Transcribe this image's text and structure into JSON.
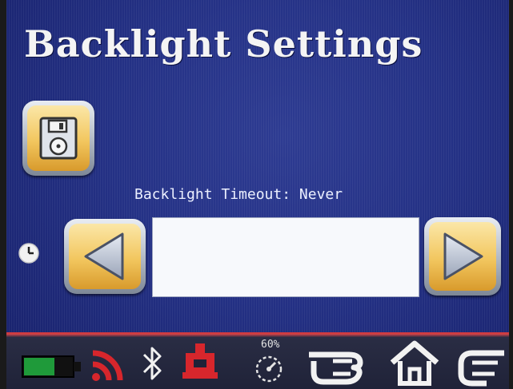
{
  "screen": {
    "title": "Backlight Settings"
  },
  "settings": {
    "timeout_label": "Backlight Timeout: Never",
    "value": ""
  },
  "buttons": {
    "save_icon": "floppy-disk-icon",
    "prev_icon": "arrow-left-icon",
    "next_icon": "arrow-right-icon",
    "timer_icon": "clock-icon"
  },
  "status_bar": {
    "battery": "battery-icon",
    "signal": "signal-icon",
    "bluetooth": "bluetooth-icon",
    "printer": "printer-icon",
    "speed_percent": "60%",
    "back": "back-hand-icon",
    "home": "home-icon",
    "forward": "forward-hand-icon"
  },
  "colors": {
    "background": "#243185",
    "button_gold": "#f2c65e",
    "accent_red": "#d23b3f",
    "battery_green": "#1f9a3a"
  }
}
